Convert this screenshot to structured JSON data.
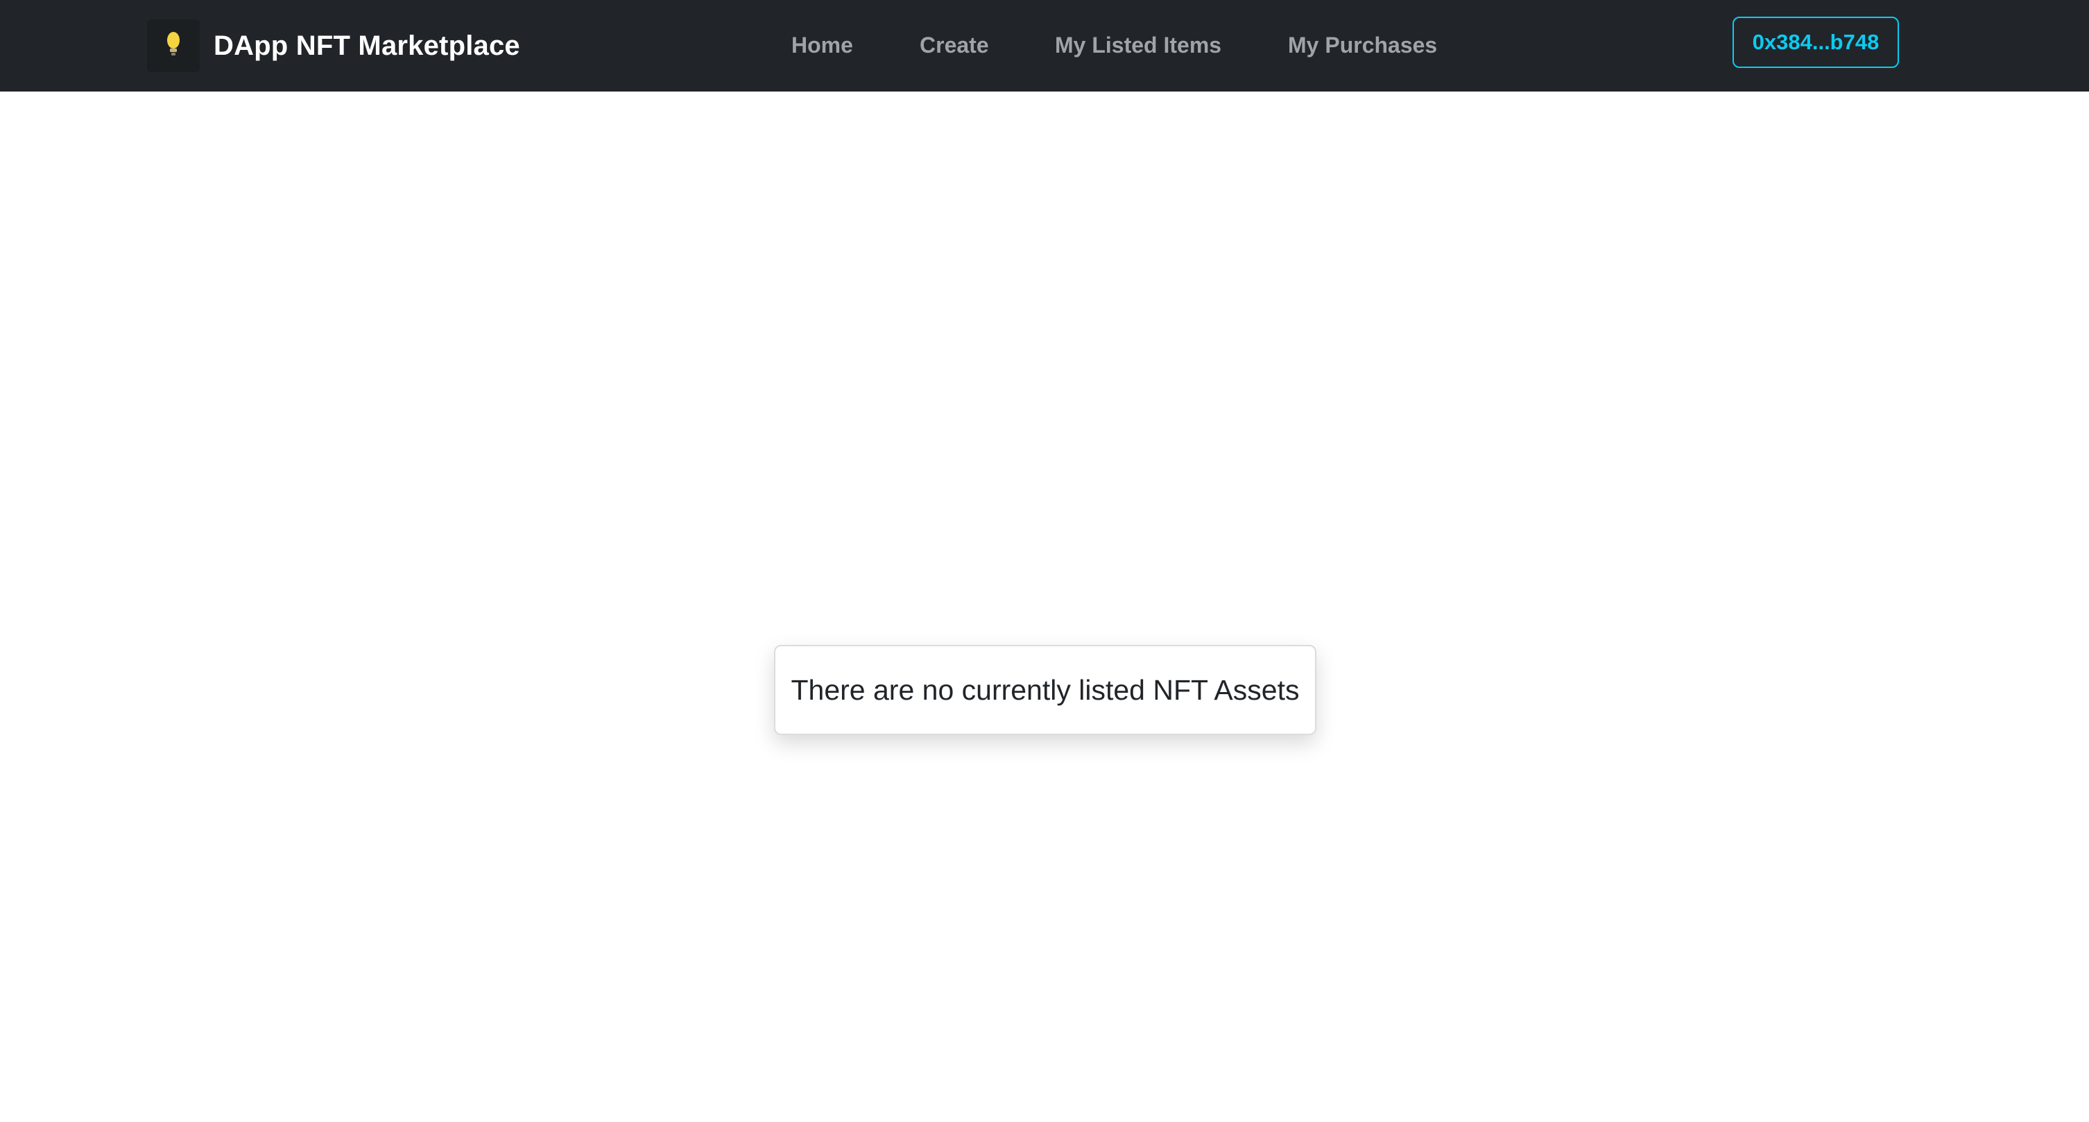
{
  "navbar": {
    "brand": {
      "name": "DApp NFT Marketplace",
      "logo_icon": "lightbulb-icon"
    },
    "links": [
      {
        "label": "Home"
      },
      {
        "label": "Create"
      },
      {
        "label": "My Listed Items"
      },
      {
        "label": "My Purchases"
      }
    ],
    "account_label": "0x384...b748"
  },
  "main": {
    "empty_message": "There are no currently listed NFT Assets"
  },
  "colors": {
    "navbar_bg": "#212529",
    "nav_link": "#a0a4a8",
    "account_accent": "#0dcaf0",
    "logo_bulb": "#f5d442"
  }
}
